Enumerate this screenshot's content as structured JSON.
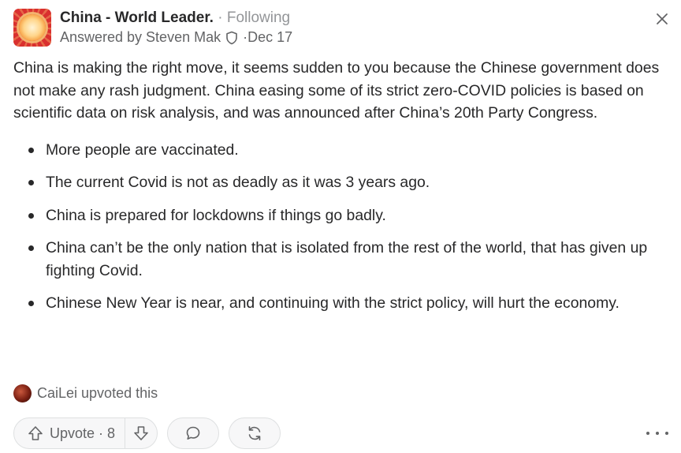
{
  "header": {
    "space_name": "China - World Leader.",
    "separator": " · ",
    "follow_status": "Following",
    "answered_by": "Answered by Steven Mak",
    "date_separator": " · ",
    "date": "Dec 17"
  },
  "answer": {
    "paragraph": "China is making the right move, it seems sudden to you because the Chinese government does not make any rash judgment. China easing some of its strict zero-COVID policies is based on scientific data on risk analysis, and was announced after China’s 20th Party Congress.",
    "bullets": [
      "More people are vaccinated.",
      "The current Covid is not as deadly as it was 3 years ago.",
      "China is prepared for lockdowns if things go badly.",
      "China can’t be the only nation that is isolated from the rest of the world, that has given up fighting Covid.",
      "Chinese New Year is near, and continuing with the strict policy, will hurt the economy."
    ]
  },
  "upvoter": {
    "text": "CaiLei upvoted this"
  },
  "actions": {
    "upvote_label": "Upvote · 8",
    "icons": [
      "arrow-up-icon",
      "arrow-down-icon",
      "comment-icon",
      "share-icon",
      "more-icon"
    ]
  },
  "colors": {
    "text": "#282829",
    "muted": "#636466",
    "light": "#939598",
    "border": "#dee0e1",
    "avatar_red": "#d9302f"
  }
}
